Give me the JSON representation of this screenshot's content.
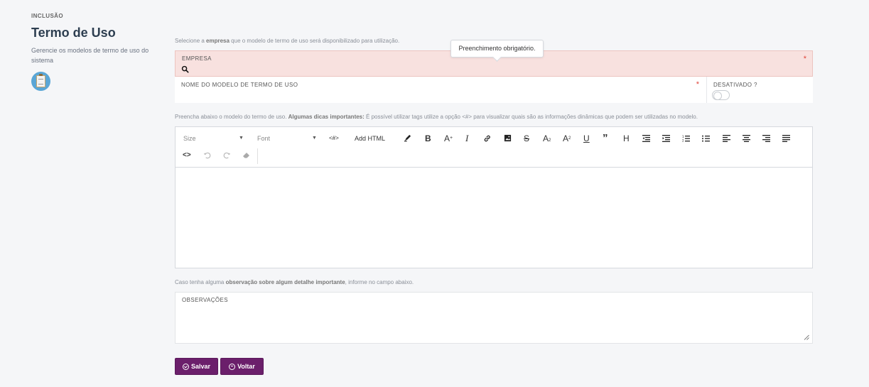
{
  "sidebar": {
    "kicker": "INCLUSÃO",
    "title": "Termo de Uso",
    "description": "Gerencie os modelos de termo de uso do sistema",
    "icon": "clipboard-icon"
  },
  "hints": {
    "empresa_pre": "Selecione a ",
    "empresa_bold": "empresa",
    "empresa_post": " que o modelo de termo de uso será disponibilizado para utilização.",
    "editor_pre": "Preencha abaixo o modelo do termo de uso. ",
    "editor_bold": "Algumas dicas importantes:",
    "editor_post": " É possível utilizar tags utilize a opção <#> para visualizar quais são as informações dinâmicas que podem ser utilizadas no modelo.",
    "obs_pre": "Caso tenha alguma ",
    "obs_bold": "observação sobre algum detalhe importante",
    "obs_post": ", informe no campo abaixo."
  },
  "tooltip": "Preenchimento obrigatório.",
  "fields": {
    "empresa_label": "EMPRESA",
    "required_mark": "*",
    "nome_label": "NOME DO MODELO DE TERMO DE USO",
    "desativado_label": "DESATIVADO ?",
    "obs_label": "OBSERVAÇÕES"
  },
  "toolbar": {
    "size": "Size",
    "font": "Font",
    "tags": "<#>",
    "add_html": "Add HTML",
    "bold": "B",
    "font_color": "A",
    "italic": "I",
    "strike": "S",
    "subscript": "A",
    "superscript": "A",
    "underline": "U",
    "quote": "”",
    "heading": "H",
    "code": "<>"
  },
  "buttons": {
    "save": "Salvar",
    "back": "Voltar"
  },
  "colors": {
    "primary": "#6b1f6b",
    "required_bg": "#f8e1df",
    "title": "#2d3e50"
  }
}
